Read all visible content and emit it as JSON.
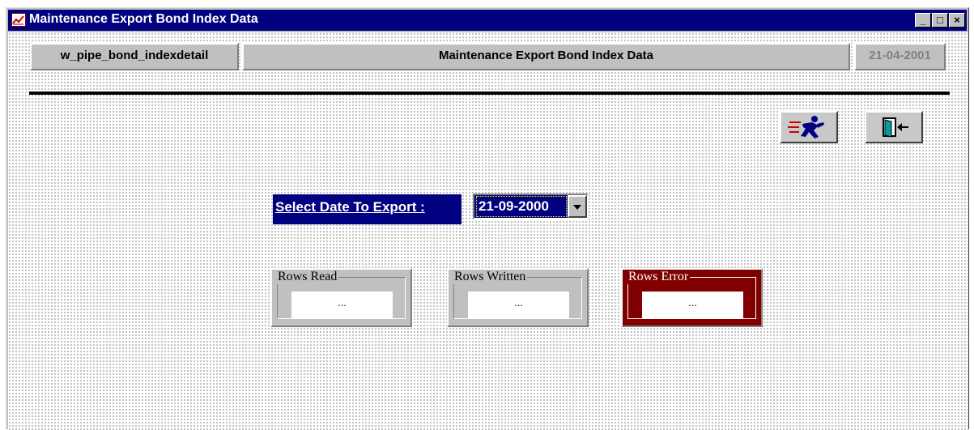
{
  "window": {
    "title": "Maintenance Export Bond Index Data",
    "controls": {
      "minimize": "_",
      "maximize": "□",
      "close": "×"
    }
  },
  "header": {
    "window_name": "w_pipe_bond_indexdetail",
    "title": "Maintenance Export Bond Index Data",
    "date": "21-04-2001"
  },
  "toolbar": {
    "run_icon": "running-man-icon",
    "exit_icon": "exit-door-icon"
  },
  "export_form": {
    "date_label": "Select Date To Export :",
    "date_value": "21-09-2000"
  },
  "counters": [
    {
      "title": "Rows Read",
      "value": "..."
    },
    {
      "title": "Rows Written",
      "value": "..."
    },
    {
      "title": "Rows Error",
      "value": "..."
    }
  ],
  "colors": {
    "title_bar": "#000080",
    "date_label_bg": "#000080",
    "error_group_bg": "#800000",
    "panel_gray": "#c0c0c0"
  }
}
